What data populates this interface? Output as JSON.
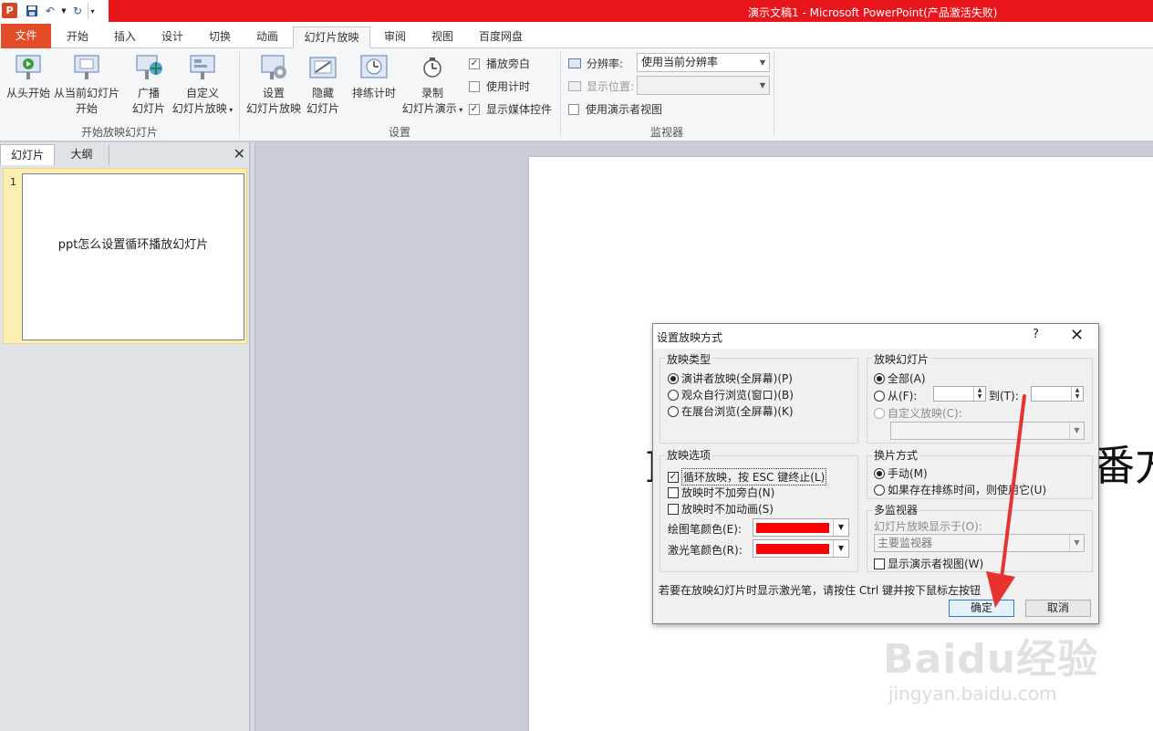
{
  "window": {
    "title": "演示文稿1 - Microsoft PowerPoint(产品激活失败)",
    "app_icon": "P"
  },
  "tabs": [
    {
      "label": "文件"
    },
    {
      "label": "开始"
    },
    {
      "label": "插入"
    },
    {
      "label": "设计"
    },
    {
      "label": "切换"
    },
    {
      "label": "动画"
    },
    {
      "label": "幻灯片放映"
    },
    {
      "label": "审阅"
    },
    {
      "label": "视图"
    },
    {
      "label": "百度网盘"
    }
  ],
  "ribbon": {
    "group_start": {
      "label": "开始放映幻灯片",
      "from_beginning": "从头开始",
      "from_current_1": "从当前幻灯片",
      "from_current_2": "开始",
      "broadcast_1": "广播",
      "broadcast_2": "幻灯片",
      "custom_1": "自定义",
      "custom_2": "幻灯片放映"
    },
    "group_setup": {
      "label": "设置",
      "setup_1": "设置",
      "setup_2": "幻灯片放映",
      "hide_1": "隐藏",
      "hide_2": "幻灯片",
      "rehearse": "排练计时",
      "record_1": "录制",
      "record_2": "幻灯片演示",
      "play_narrations": "播放旁白",
      "use_timings": "使用计时",
      "show_media_controls": "显示媒体控件"
    },
    "group_monitors": {
      "label": "监视器",
      "resolution_label": "分辨率:",
      "resolution_value": "使用当前分辨率",
      "show_on_label": "显示位置:",
      "presenter_view": "使用演示者视图"
    }
  },
  "left_panel": {
    "tab_slides": "幻灯片",
    "tab_outline": "大纲",
    "slide_number": "1",
    "slide_text": "ppt怎么设置循环播放幻灯片"
  },
  "slide": {
    "fragment_left": "I",
    "fragment_right": "番方"
  },
  "dialog": {
    "title": "设置放映方式",
    "help": "?",
    "show_type": {
      "legend": "放映类型",
      "opt1": "演讲者放映(全屏幕)(P)",
      "opt2": "观众自行浏览(窗口)(B)",
      "opt3": "在展台浏览(全屏幕)(K)"
    },
    "show_slides": {
      "legend": "放映幻灯片",
      "all": "全部(A)",
      "from": "从(F):",
      "to": "到(T):",
      "custom": "自定义放映(C):"
    },
    "show_options": {
      "legend": "放映选项",
      "loop": "循环放映，按 ESC 键终止(L)",
      "no_narration": "放映时不加旁白(N)",
      "no_animation": "放映时不加动画(S)",
      "pen_color": "绘图笔颜色(E):",
      "laser_color": "激光笔颜色(R):",
      "pen_color_value": "#ff0000",
      "laser_color_value": "#ff0000"
    },
    "advance": {
      "legend": "换片方式",
      "manual": "手动(M)",
      "timings": "如果存在排练时间，则使用它(U)"
    },
    "monitors": {
      "legend": "多监视器",
      "show_on": "幻灯片放映显示于(O):",
      "monitor_value": "主要监视器",
      "presenter_view": "显示演示者视图(W)"
    },
    "hint": "若要在放映幻灯片时显示激光笔，请按住 Ctrl 键并按下鼠标左按钮",
    "ok": "确定",
    "cancel": "取消"
  },
  "watermark": {
    "logo": "Baidu经验",
    "url": "jingyan.baidu.com"
  },
  "colors": {
    "titlebar_red": "#e8161b",
    "file_tab": "#e34c26",
    "annotation_arrow": "#e8322f"
  }
}
